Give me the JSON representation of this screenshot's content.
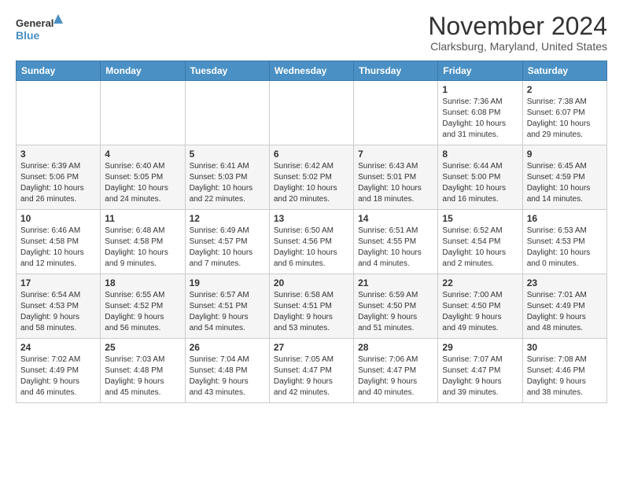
{
  "header": {
    "logo_line1": "General",
    "logo_line2": "Blue",
    "month": "November 2024",
    "location": "Clarksburg, Maryland, United States"
  },
  "days_of_week": [
    "Sunday",
    "Monday",
    "Tuesday",
    "Wednesday",
    "Thursday",
    "Friday",
    "Saturday"
  ],
  "weeks": [
    [
      {
        "day": "",
        "info": ""
      },
      {
        "day": "",
        "info": ""
      },
      {
        "day": "",
        "info": ""
      },
      {
        "day": "",
        "info": ""
      },
      {
        "day": "",
        "info": ""
      },
      {
        "day": "1",
        "info": "Sunrise: 7:36 AM\nSunset: 6:08 PM\nDaylight: 10 hours\nand 31 minutes."
      },
      {
        "day": "2",
        "info": "Sunrise: 7:38 AM\nSunset: 6:07 PM\nDaylight: 10 hours\nand 29 minutes."
      }
    ],
    [
      {
        "day": "3",
        "info": "Sunrise: 6:39 AM\nSunset: 5:06 PM\nDaylight: 10 hours\nand 26 minutes."
      },
      {
        "day": "4",
        "info": "Sunrise: 6:40 AM\nSunset: 5:05 PM\nDaylight: 10 hours\nand 24 minutes."
      },
      {
        "day": "5",
        "info": "Sunrise: 6:41 AM\nSunset: 5:03 PM\nDaylight: 10 hours\nand 22 minutes."
      },
      {
        "day": "6",
        "info": "Sunrise: 6:42 AM\nSunset: 5:02 PM\nDaylight: 10 hours\nand 20 minutes."
      },
      {
        "day": "7",
        "info": "Sunrise: 6:43 AM\nSunset: 5:01 PM\nDaylight: 10 hours\nand 18 minutes."
      },
      {
        "day": "8",
        "info": "Sunrise: 6:44 AM\nSunset: 5:00 PM\nDaylight: 10 hours\nand 16 minutes."
      },
      {
        "day": "9",
        "info": "Sunrise: 6:45 AM\nSunset: 4:59 PM\nDaylight: 10 hours\nand 14 minutes."
      }
    ],
    [
      {
        "day": "10",
        "info": "Sunrise: 6:46 AM\nSunset: 4:58 PM\nDaylight: 10 hours\nand 12 minutes."
      },
      {
        "day": "11",
        "info": "Sunrise: 6:48 AM\nSunset: 4:58 PM\nDaylight: 10 hours\nand 9 minutes."
      },
      {
        "day": "12",
        "info": "Sunrise: 6:49 AM\nSunset: 4:57 PM\nDaylight: 10 hours\nand 7 minutes."
      },
      {
        "day": "13",
        "info": "Sunrise: 6:50 AM\nSunset: 4:56 PM\nDaylight: 10 hours\nand 6 minutes."
      },
      {
        "day": "14",
        "info": "Sunrise: 6:51 AM\nSunset: 4:55 PM\nDaylight: 10 hours\nand 4 minutes."
      },
      {
        "day": "15",
        "info": "Sunrise: 6:52 AM\nSunset: 4:54 PM\nDaylight: 10 hours\nand 2 minutes."
      },
      {
        "day": "16",
        "info": "Sunrise: 6:53 AM\nSunset: 4:53 PM\nDaylight: 10 hours\nand 0 minutes."
      }
    ],
    [
      {
        "day": "17",
        "info": "Sunrise: 6:54 AM\nSunset: 4:53 PM\nDaylight: 9 hours\nand 58 minutes."
      },
      {
        "day": "18",
        "info": "Sunrise: 6:55 AM\nSunset: 4:52 PM\nDaylight: 9 hours\nand 56 minutes."
      },
      {
        "day": "19",
        "info": "Sunrise: 6:57 AM\nSunset: 4:51 PM\nDaylight: 9 hours\nand 54 minutes."
      },
      {
        "day": "20",
        "info": "Sunrise: 6:58 AM\nSunset: 4:51 PM\nDaylight: 9 hours\nand 53 minutes."
      },
      {
        "day": "21",
        "info": "Sunrise: 6:59 AM\nSunset: 4:50 PM\nDaylight: 9 hours\nand 51 minutes."
      },
      {
        "day": "22",
        "info": "Sunrise: 7:00 AM\nSunset: 4:50 PM\nDaylight: 9 hours\nand 49 minutes."
      },
      {
        "day": "23",
        "info": "Sunrise: 7:01 AM\nSunset: 4:49 PM\nDaylight: 9 hours\nand 48 minutes."
      }
    ],
    [
      {
        "day": "24",
        "info": "Sunrise: 7:02 AM\nSunset: 4:49 PM\nDaylight: 9 hours\nand 46 minutes."
      },
      {
        "day": "25",
        "info": "Sunrise: 7:03 AM\nSunset: 4:48 PM\nDaylight: 9 hours\nand 45 minutes."
      },
      {
        "day": "26",
        "info": "Sunrise: 7:04 AM\nSunset: 4:48 PM\nDaylight: 9 hours\nand 43 minutes."
      },
      {
        "day": "27",
        "info": "Sunrise: 7:05 AM\nSunset: 4:47 PM\nDaylight: 9 hours\nand 42 minutes."
      },
      {
        "day": "28",
        "info": "Sunrise: 7:06 AM\nSunset: 4:47 PM\nDaylight: 9 hours\nand 40 minutes."
      },
      {
        "day": "29",
        "info": "Sunrise: 7:07 AM\nSunset: 4:47 PM\nDaylight: 9 hours\nand 39 minutes."
      },
      {
        "day": "30",
        "info": "Sunrise: 7:08 AM\nSunset: 4:46 PM\nDaylight: 9 hours\nand 38 minutes."
      }
    ]
  ]
}
